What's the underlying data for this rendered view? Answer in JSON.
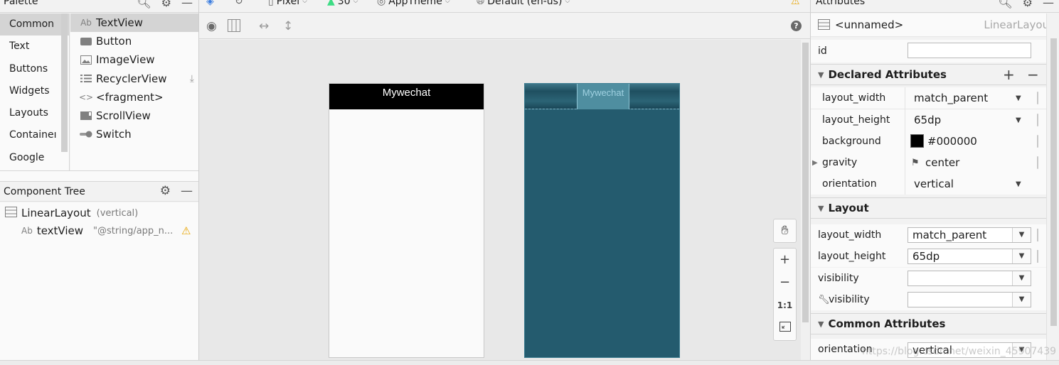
{
  "palette": {
    "title": "Palette",
    "categories": [
      "Common",
      "Text",
      "Buttons",
      "Widgets",
      "Layouts",
      "Containeı",
      "Google"
    ],
    "items": [
      {
        "label": "TextView",
        "icon": "ab-icon"
      },
      {
        "label": "Button",
        "icon": "button-icon"
      },
      {
        "label": "ImageView",
        "icon": "image-icon"
      },
      {
        "label": "RecyclerView",
        "icon": "list-icon"
      },
      {
        "label": "<fragment>",
        "icon": "code-icon"
      },
      {
        "label": "ScrollView",
        "icon": "scroll-icon"
      },
      {
        "label": "Switch",
        "icon": "switch-icon"
      }
    ]
  },
  "component_tree": {
    "title": "Component Tree",
    "root": {
      "label": "LinearLayout",
      "detail": "(vertical)"
    },
    "child": {
      "label": "textView",
      "detail": "\"@string/app_n..."
    }
  },
  "toolbar": {
    "device": "Pixel",
    "api": "30",
    "theme": "AppTheme",
    "locale": "Default (en-us)"
  },
  "canvas": {
    "app_title": "Mywechat",
    "blueprint_title": "Mywechat",
    "zoom_fit_label": "1:1"
  },
  "attributes": {
    "title": "Attributes",
    "component_name": "<unnamed>",
    "component_type": "LinearLayout",
    "id_label": "id",
    "id_value": "",
    "declared": {
      "title": "Declared Attributes",
      "rows": [
        {
          "label": "layout_width",
          "value": "match_parent"
        },
        {
          "label": "layout_height",
          "value": "65dp"
        },
        {
          "label": "background",
          "value": "#000000"
        },
        {
          "label": "gravity",
          "value": "center"
        },
        {
          "label": "orientation",
          "value": "vertical"
        }
      ]
    },
    "layout": {
      "title": "Layout",
      "rows": [
        {
          "label": "layout_width",
          "value": "match_parent"
        },
        {
          "label": "layout_height",
          "value": "65dp"
        },
        {
          "label": "visibility",
          "value": ""
        },
        {
          "label": "visibility",
          "value": ""
        }
      ]
    },
    "common": {
      "title": "Common Attributes",
      "rows": [
        {
          "label": "orientation",
          "value": "vertical"
        }
      ]
    }
  },
  "watermark": "https://blog.csdn.net/weixin_45907439",
  "colors": {
    "blueprint": "#245b6e",
    "warning": "#e8a400",
    "background_swatch": "#000000"
  }
}
